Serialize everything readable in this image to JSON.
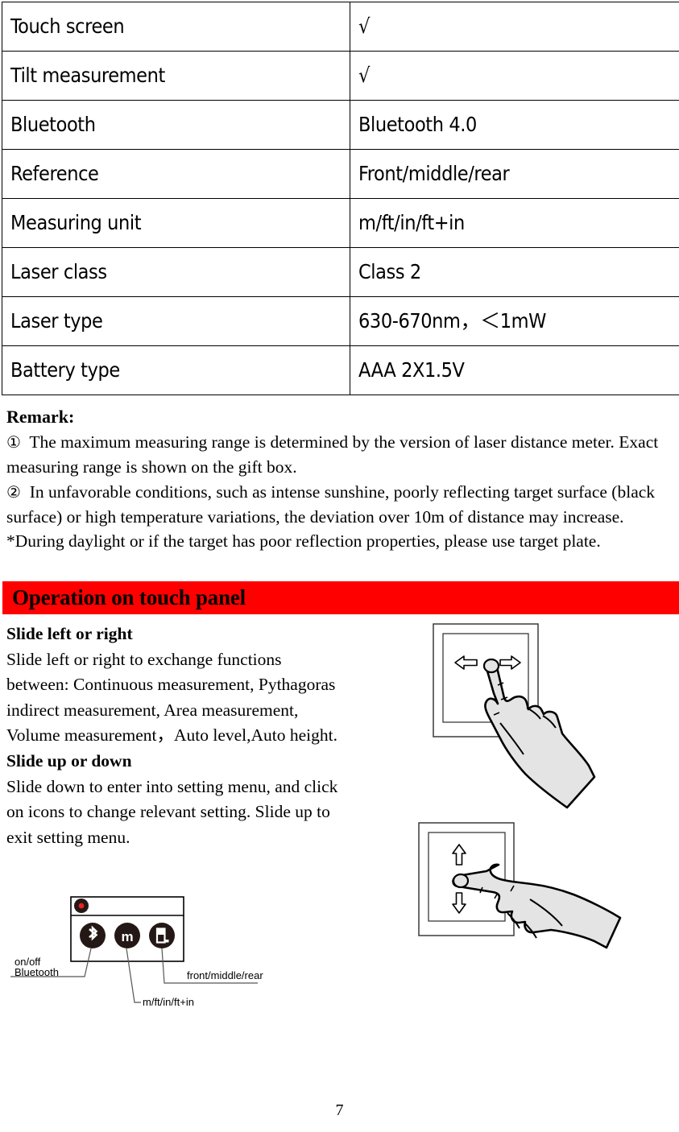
{
  "spec_table": {
    "rows": [
      {
        "label": "Touch screen",
        "value": "√",
        "is_check": true
      },
      {
        "label": "Tilt measurement",
        "value": "√",
        "is_check": true
      },
      {
        "label": "Bluetooth",
        "value": "Bluetooth 4.0",
        "is_check": false
      },
      {
        "label": "Reference",
        "value": "Front/middle/rear",
        "is_check": false
      },
      {
        "label": "Measuring unit",
        "value": "m/ft/in/ft+in",
        "is_check": false
      },
      {
        "label": "Laser class",
        "value": "Class 2",
        "is_check": false
      },
      {
        "label": "Laser type",
        "value": "630-670nm，＜1mW",
        "is_check": false
      },
      {
        "label": "Battery type",
        "value": "AAA 2X1.5V",
        "is_check": false
      }
    ]
  },
  "remark": {
    "title": "Remark:",
    "item1_marker": "①",
    "item1": "The maximum measuring range is determined by the version of laser distance meter. Exact measuring range is shown on the gift box.",
    "item2_marker": "②",
    "item2": "In unfavorable conditions, such as intense sunshine, poorly reflecting target surface (black surface) or high temperature variations, the deviation over 10m of distance may increase.",
    "note": "*During daylight or if the target has poor reflection properties, please use target plate."
  },
  "section_header": {
    "title": "Operation on touch panel",
    "background_color": "#FF0000",
    "text_color": "#000000"
  },
  "instructions": {
    "heading_lr": "Slide left or right",
    "body_lr": "Slide left or right to exchange functions between: Continuous measurement, Pythagoras indirect measurement, Area measurement, Volume measurement，Auto level,Auto height.",
    "heading_ud": "Slide up or down",
    "body_ud": "Slide down to enter into setting menu, and click on icons to change relevant setting. Slide up to exit setting menu."
  },
  "settings_diagram": {
    "gear_icon": "gear-icon",
    "gear_center_color": "#E8241F",
    "icons": [
      {
        "name": "bluetooth-icon",
        "glyph": "ᛗ",
        "label": "on/off\nBluetooth"
      },
      {
        "name": "measuring-unit-icon",
        "glyph": "m",
        "label": "m/ft/in/ft+in"
      },
      {
        "name": "reference-point-icon",
        "glyph": "",
        "label": "front/middle/rear"
      }
    ],
    "label_bluetooth_line1": "on/off",
    "label_bluetooth_line2": "Bluetooth",
    "label_unit": "m/ft/in/ft+in",
    "label_reference": "front/middle/rear",
    "icon_fill": "#231815"
  },
  "hand_figures": {
    "left_right": {
      "name": "slide-left-right-illustration",
      "arrow_left": "⇐",
      "arrow_right": "⇒"
    },
    "up_down": {
      "name": "slide-up-down-illustration",
      "arrow_up": "⇑",
      "arrow_down": "⇓"
    },
    "hand_fill": "#E4E4E4",
    "outline_color": "#000000"
  },
  "footer": {
    "page_number": "7"
  }
}
